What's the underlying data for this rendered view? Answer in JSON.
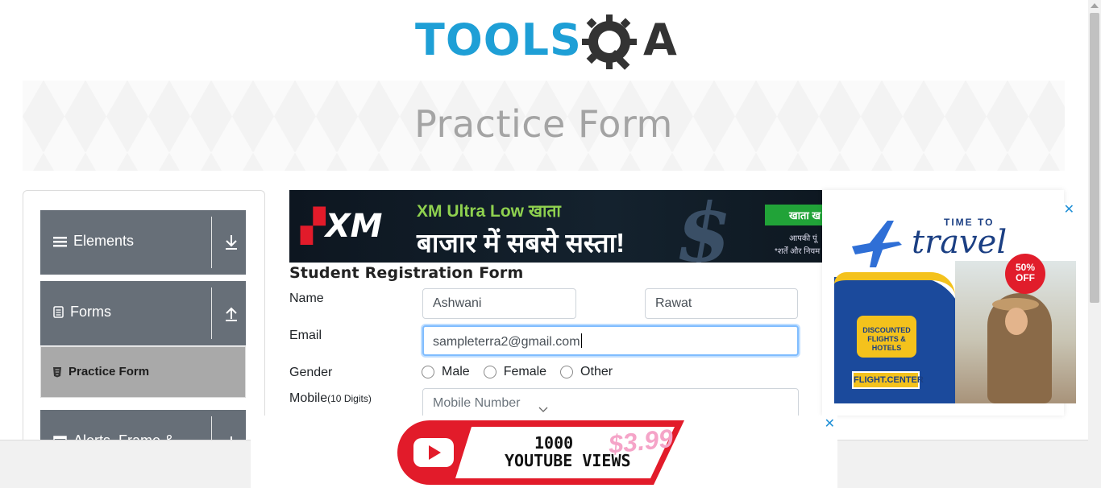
{
  "header": {
    "logo_text_left": "TOOLS",
    "logo_text_right": "A"
  },
  "banner": {
    "title": "Practice Form"
  },
  "sidebar": {
    "groups": [
      {
        "label": "Elements",
        "icon": "hamburger-icon",
        "arrow": "download-arrow-icon"
      },
      {
        "label": "Forms",
        "icon": "document-icon",
        "arrow": "upload-arrow-icon"
      },
      {
        "label": "Alerts, Frame &",
        "icon": "window-icon",
        "arrow": "plus-icon"
      }
    ],
    "active_item": {
      "label": "Practice Form",
      "icon": "html5-shield-icon"
    }
  },
  "ad_top": {
    "brand": "XM",
    "line1": "XM Ultra Low खाता",
    "line2": "बाजार में सबसे सस्ता!",
    "cta": "खाता ख",
    "fine1": "आपकी पूं",
    "fine2": "*शर्तें और नियम"
  },
  "form": {
    "title": "Student Registration Form",
    "name_label": "Name",
    "first_name": "Ashwani",
    "last_name": "Rawat",
    "email_label": "Email",
    "email_value": "sampleterra2@gmail.com",
    "gender_label": "Gender",
    "gender_options": [
      "Male",
      "Female",
      "Other"
    ],
    "mobile_label": "Mobile",
    "mobile_hint": "(10 Digits)",
    "mobile_placeholder": "Mobile Number"
  },
  "ad_right": {
    "close": "✕",
    "time_to": "TIME TO",
    "travel": "travel",
    "discount": "50% OFF",
    "deal": "DISCOUNTED FLIGHTS & HOTELS",
    "brand": "FLIGHT.CENTER"
  },
  "ad_bottom": {
    "close": "✕",
    "views_line1": "1000",
    "views_line2": "YOUTUBE VIEWS",
    "price": "$3.99"
  },
  "colors": {
    "accent": "#1e9fd6",
    "sidebar": "#676f78",
    "active": "#a9a9a9",
    "focus": "#80bdff"
  }
}
